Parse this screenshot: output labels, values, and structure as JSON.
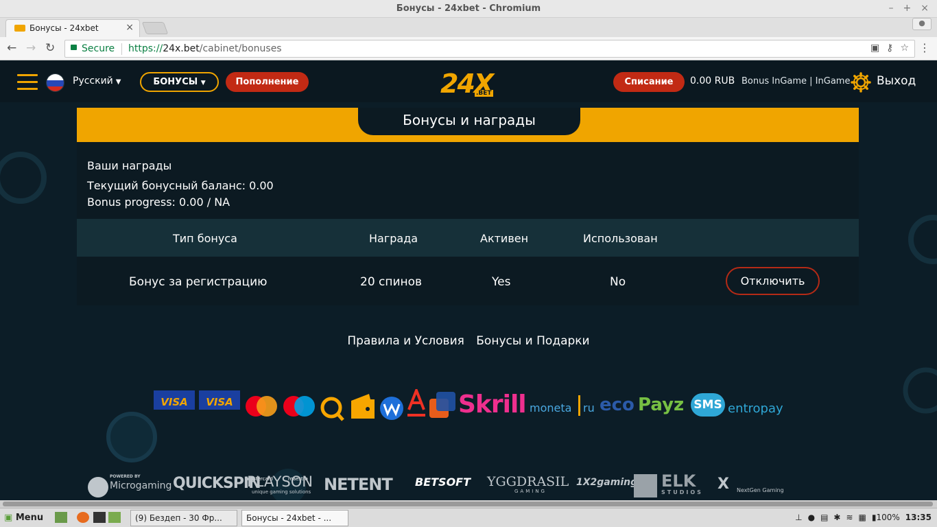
{
  "browser": {
    "window_title": "Бонусы - 24xbet - Chromium",
    "tab_title": "Бонусы - 24xbet",
    "secure_label": "Secure",
    "url_scheme": "https://",
    "url_host": "24x.bet",
    "url_path": "/cabinet/bonuses"
  },
  "header": {
    "language": "Русский",
    "bonus_button": "БОНУСЫ",
    "deposit_button": "Пополнение",
    "logo_main": "24X",
    "logo_sub": ".BET",
    "withdraw_button": "Списание",
    "balance": "0.00 RUB",
    "bonus_ingame": "Bonus InGame | InGame",
    "logout": "Выход"
  },
  "panel": {
    "title": "Бонусы и награды",
    "your_awards": "Ваши награды",
    "bonus_balance": "Текущий бонусный баланс: 0.00",
    "bonus_progress": "Bonus progress: 0.00 / NA",
    "columns": [
      "Тип бонуса",
      "Награда",
      "Активен",
      "Использован"
    ],
    "row": {
      "type": "Бонус за регистрацию",
      "reward": "20 спинов",
      "active": "Yes",
      "used": "No",
      "action": "Отключить"
    }
  },
  "footer": {
    "links": [
      "Правила и Условия",
      "Бонусы и Подарки"
    ],
    "payments": [
      "VISA",
      "VISA",
      "mastercard",
      "maestro",
      "Skrill",
      "moneta",
      "ru",
      "eco",
      "Payz",
      "SMS",
      "entropay"
    ],
    "providers": [
      "Microgaming",
      "QUICKSPIN",
      "PLAYSON",
      "NETENT",
      "BETSOFT",
      "YGGDRASIL",
      "1X2gaming",
      "ELK",
      "NextGen Gaming"
    ],
    "microgaming_powered": "POWERED BY",
    "playson_sub": "unique gaming solutions",
    "yggdrasil_sub": "GAMING",
    "elk_sub": "STUDIOS"
  },
  "taskbar": {
    "menu": "Menu",
    "win1": "(9) Бездеп - 30 Фр...",
    "win2": "Бонусы - 24xbet - ...",
    "battery": "100%",
    "clock": "13:35"
  },
  "colors": {
    "accent": "#f0a500",
    "red": "#c22a14",
    "background": "#0c1d27",
    "table_header": "#163039"
  }
}
